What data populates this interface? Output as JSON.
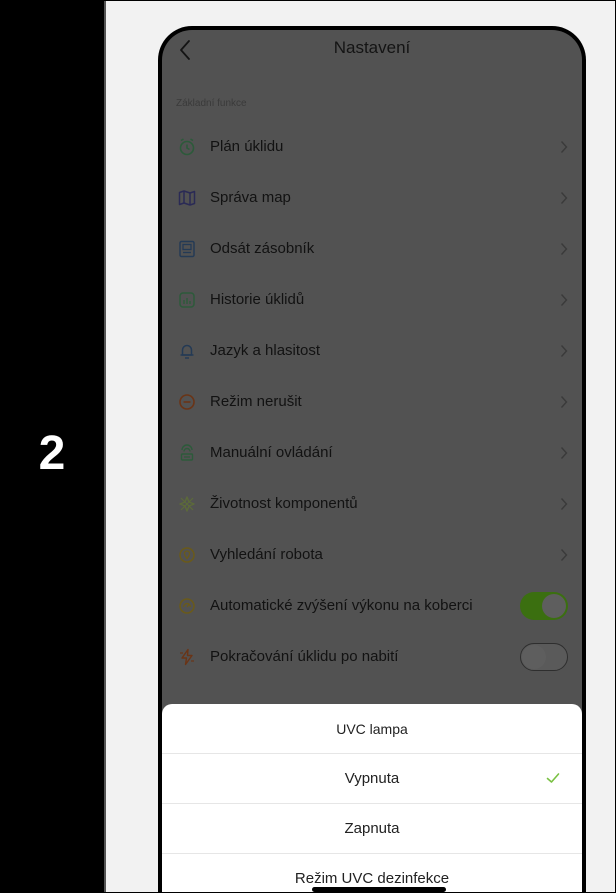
{
  "step": {
    "number": "2"
  },
  "header": {
    "title": "Nastavení"
  },
  "section": {
    "label": "Základní funkce"
  },
  "rows": [
    {
      "label": "Plán úklidu",
      "icon": "clock-icon",
      "color": "#2c5a3a"
    },
    {
      "label": "Správa map",
      "icon": "map-icon",
      "color": "#2a2a55"
    },
    {
      "label": "Odsát zásobník",
      "icon": "dustbin-icon",
      "color": "#243a55"
    },
    {
      "label": "Historie úklidů",
      "icon": "history-icon",
      "color": "#2c5a3a"
    },
    {
      "label": "Jazyk a hlasitost",
      "icon": "bell-icon",
      "color": "#243a55"
    },
    {
      "label": "Režim nerušit",
      "icon": "do-not-disturb-icon",
      "color": "#6a3416"
    },
    {
      "label": "Manuální ovládání",
      "icon": "remote-control-icon",
      "color": "#2c5a3a"
    },
    {
      "label": "Životnost komponentů",
      "icon": "components-icon",
      "color": "#5c6a3a"
    },
    {
      "label": "Vyhledání robota",
      "icon": "location-pin-icon",
      "color": "#6a5a1a"
    },
    {
      "label": "Automatické zvýšení výkonu na koberci",
      "icon": "carpet-boost-icon",
      "color": "#6a5a1a",
      "toggle": "on"
    },
    {
      "label": "Pokračování úklidu po nabití",
      "icon": "charging-icon",
      "color": "#6a3416",
      "toggle": "off"
    }
  ],
  "sheet": {
    "title": "UVC lampa",
    "options": [
      {
        "label": "Vypnuta",
        "selected": true
      },
      {
        "label": "Zapnuta",
        "selected": false
      }
    ],
    "footer": "Režim UVC dezinfekce"
  },
  "colors": {
    "accent": "#3b6f10",
    "check": "#7ac143",
    "overlay": "#525252"
  }
}
